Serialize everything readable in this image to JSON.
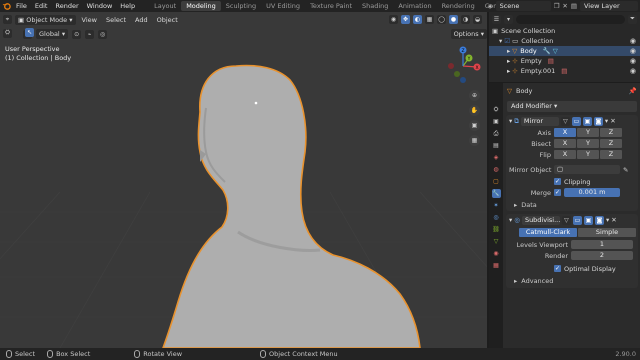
{
  "menu": {
    "items": [
      "File",
      "Edit",
      "Render",
      "Window",
      "Help"
    ]
  },
  "workspaces": {
    "tabs": [
      "Layout",
      "Modeling",
      "Sculpting",
      "UV Editing",
      "Texture Paint",
      "Shading",
      "Animation",
      "Rendering",
      "Comp"
    ],
    "active_index": 1
  },
  "top_right": {
    "scene": "Scene",
    "view_layer": "View Layer"
  },
  "viewport": {
    "mode": "Object Mode",
    "menus": [
      "View",
      "Select",
      "Add",
      "Object"
    ],
    "transform_orientation": "Global",
    "options_label": "Options",
    "view_name": "User Perspective",
    "context": "(1) Collection | Body",
    "gizmo_axes": [
      "X",
      "Y",
      "Z"
    ]
  },
  "outliner": {
    "title": "Scene Collection",
    "rows": [
      {
        "label": "Collection",
        "selected": false
      },
      {
        "label": "Body",
        "selected": true
      },
      {
        "label": "Empty",
        "selected": false
      },
      {
        "label": "Empty.001",
        "selected": false
      }
    ]
  },
  "properties": {
    "object_name": "Body",
    "add_modifier": "Add Modifier",
    "mirror": {
      "name": "Mirror",
      "axis_label": "Axis",
      "bisect_label": "Bisect",
      "flip_label": "Flip",
      "axes": [
        "X",
        "Y",
        "Z"
      ],
      "mirror_object_label": "Mirror Object",
      "clipping_label": "Clipping",
      "merge_label": "Merge",
      "merge_value": "0.001 m",
      "data_label": "Data"
    },
    "subdivision": {
      "name": "Subdivisi...",
      "catmull_label": "Catmull-Clark",
      "simple_label": "Simple",
      "levels_viewport_label": "Levels Viewport",
      "levels_viewport_value": "1",
      "render_label": "Render",
      "render_value": "2",
      "optimal_display_label": "Optimal Display",
      "advanced_label": "Advanced"
    }
  },
  "statusbar": {
    "select": "Select",
    "box_select": "Box Select",
    "rotate_view": "Rotate View",
    "context_menu": "Object Context Menu",
    "version": "2.90.0"
  },
  "colors": {
    "accent": "#4772b3",
    "selection_outline": "#e8922e",
    "viewport_bg": "#393939",
    "x_axis": "#e0434b",
    "y_axis": "#84b62e",
    "z_axis": "#3b7ddd"
  }
}
